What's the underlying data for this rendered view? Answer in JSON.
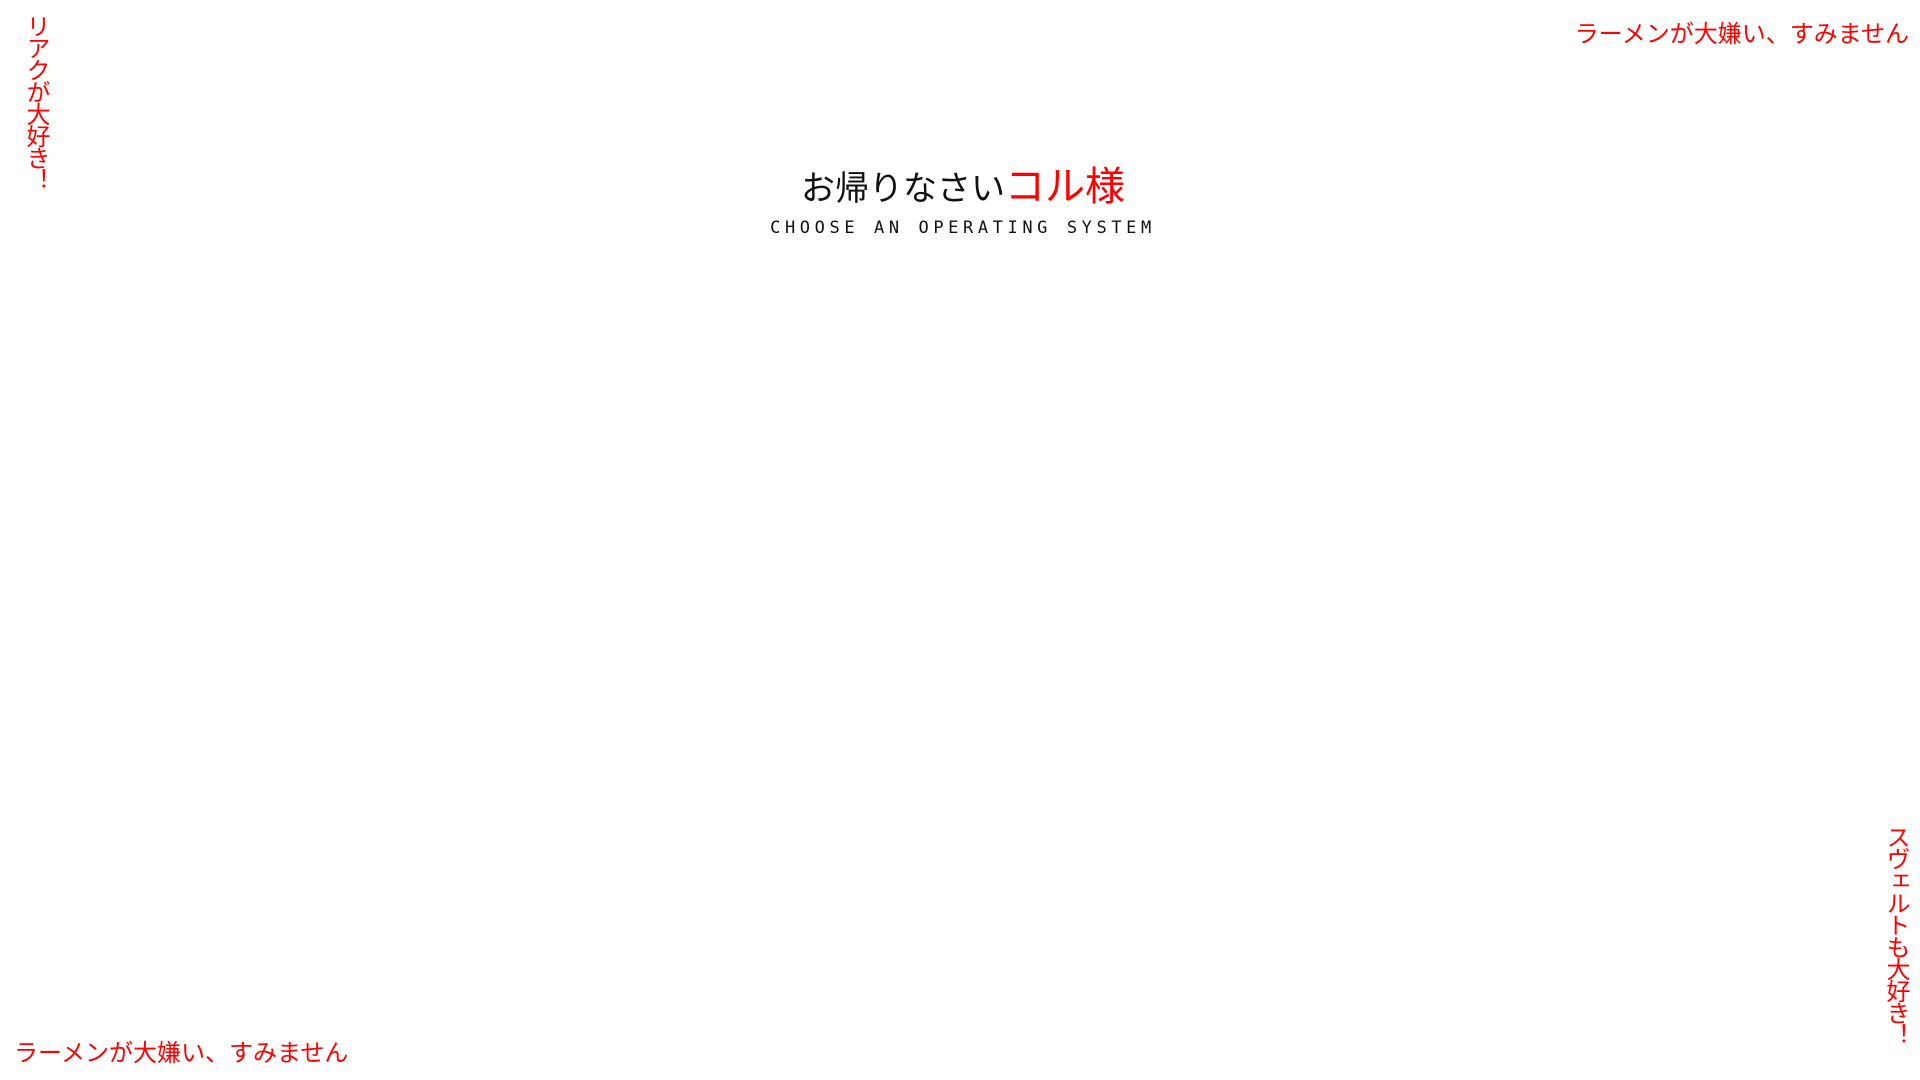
{
  "corners": {
    "top_left": "リアクが大好き！",
    "top_right": "ラーメンが大嫌い、すみません",
    "bottom_left": "ラーメンが大嫌い、すみません",
    "bottom_right": "スヴェルトも大好き！"
  },
  "greeting": {
    "text": "お帰りなさい",
    "name": "コル様"
  },
  "subtitle": "CHOOSE AN OPERATING SYSTEM",
  "colors": {
    "accent": "#ff0000",
    "text": "#111111",
    "background": "#ffffff"
  }
}
